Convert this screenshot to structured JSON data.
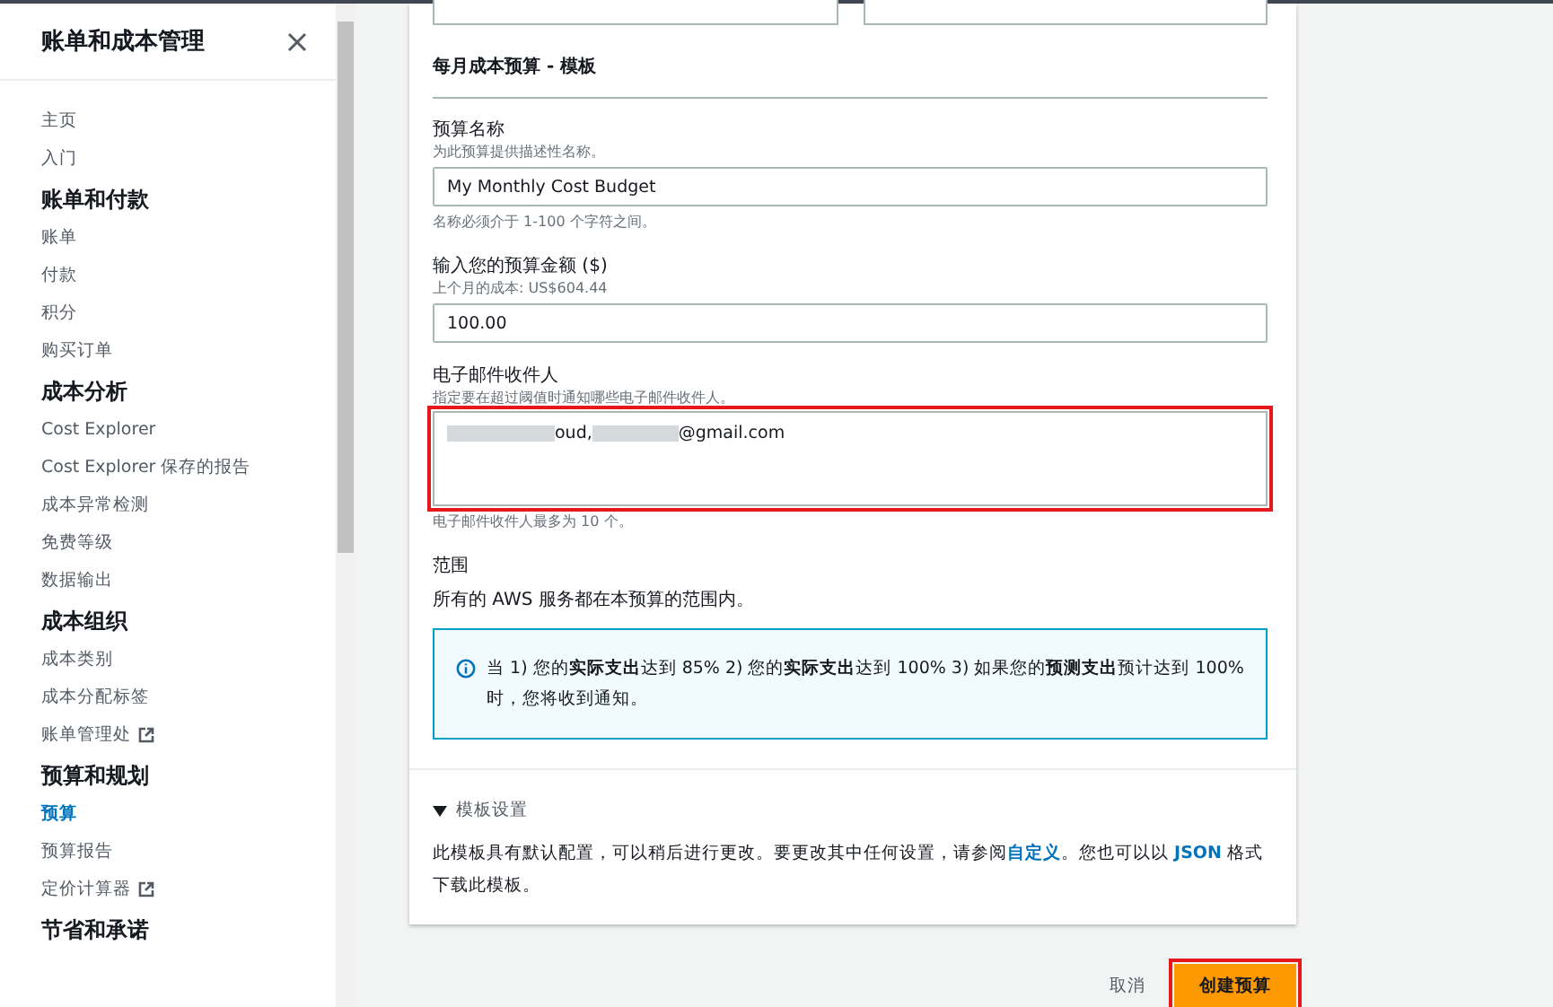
{
  "sidebar": {
    "title": "账单和成本管理",
    "items": [
      {
        "kind": "link",
        "label": "主页",
        "selected": false,
        "external": false
      },
      {
        "kind": "link",
        "label": "入门",
        "selected": false,
        "external": false
      },
      {
        "kind": "heading",
        "label": "账单和付款"
      },
      {
        "kind": "link",
        "label": "账单",
        "selected": false,
        "external": false
      },
      {
        "kind": "link",
        "label": "付款",
        "selected": false,
        "external": false
      },
      {
        "kind": "link",
        "label": "积分",
        "selected": false,
        "external": false
      },
      {
        "kind": "link",
        "label": "购买订单",
        "selected": false,
        "external": false
      },
      {
        "kind": "heading",
        "label": "成本分析"
      },
      {
        "kind": "link",
        "label": "Cost Explorer",
        "selected": false,
        "external": false
      },
      {
        "kind": "link",
        "label": "Cost Explorer 保存的报告",
        "selected": false,
        "external": false
      },
      {
        "kind": "link",
        "label": "成本异常检测",
        "selected": false,
        "external": false
      },
      {
        "kind": "link",
        "label": "免费等级",
        "selected": false,
        "external": false
      },
      {
        "kind": "link",
        "label": "数据输出",
        "selected": false,
        "external": false
      },
      {
        "kind": "heading",
        "label": "成本组织"
      },
      {
        "kind": "link",
        "label": "成本类别",
        "selected": false,
        "external": false
      },
      {
        "kind": "link",
        "label": "成本分配标签",
        "selected": false,
        "external": false
      },
      {
        "kind": "link",
        "label": "账单管理处",
        "selected": false,
        "external": true
      },
      {
        "kind": "heading",
        "label": "预算和规划"
      },
      {
        "kind": "link",
        "label": "预算",
        "selected": true,
        "external": false
      },
      {
        "kind": "link",
        "label": "预算报告",
        "selected": false,
        "external": false
      },
      {
        "kind": "link",
        "label": "定价计算器",
        "selected": false,
        "external": true
      },
      {
        "kind": "heading",
        "label": "节省和承诺"
      }
    ]
  },
  "form": {
    "section_title": "每月成本预算 - 模板",
    "budget_name": {
      "label": "预算名称",
      "description": "为此预算提供描述性名称。",
      "value": "My Monthly Cost Budget",
      "hint": "名称必须介于 1-100 个字符之间。"
    },
    "budget_amount": {
      "label": "输入您的预算金额 ($)",
      "description": "上个月的成本: US$604.44",
      "value": "100.00"
    },
    "email_recipients": {
      "label": "电子邮件收件人",
      "description": "指定要在超过阈值时通知哪些电子邮件收件人。",
      "value_parts": [
        "oud,",
        "@gmail.com"
      ],
      "hint": "电子邮件收件人最多为 10 个。",
      "highlighted": true
    },
    "scope": {
      "label": "范围",
      "text": "所有的 AWS 服务都在本预算的范围内。"
    },
    "info": "当 1) 您的**实际支出**达到 85% 2) 您的**实际支出**达到 100% 3) 如果您的**预测支出**预计达到 100% 时，您将收到通知。",
    "template_settings": {
      "label": "模板设置",
      "expanded": true,
      "text_parts": [
        {
          "kind": "text",
          "text": "此模板具有默认配置，可以稍后进行更改。要更改其中任何设置，请参阅"
        },
        {
          "kind": "link",
          "text": "自定义"
        },
        {
          "kind": "text",
          "text": "。您也可以以 "
        },
        {
          "kind": "link",
          "text": "JSON"
        },
        {
          "kind": "text",
          "text": " 格式下载此模板。"
        }
      ]
    }
  },
  "buttons": [
    {
      "kind": "link",
      "label": "取消"
    },
    {
      "kind": "primary",
      "label": "创建预算",
      "highlighted": true
    }
  ]
}
